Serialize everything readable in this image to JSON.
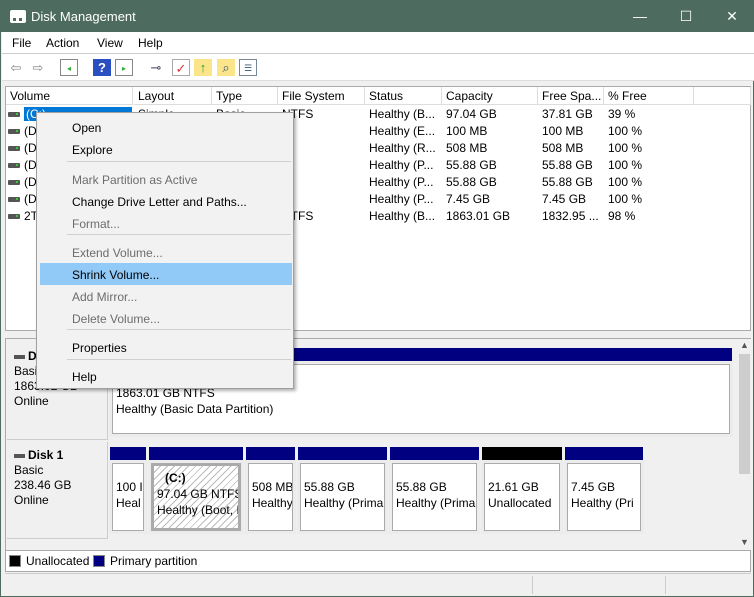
{
  "window": {
    "title": "Disk Management",
    "minimize": "—",
    "maximize": "☐",
    "close": "✕"
  },
  "menu": [
    "File",
    "Action",
    "View",
    "Help"
  ],
  "toolbar": [
    "back-icon",
    "forward-icon",
    "show-hide-console-tree-icon",
    "help-icon",
    "show-hide-action-pane-icon",
    "connect-disk-icon",
    "check-icon",
    "folder-up-icon",
    "search-folder-icon",
    "properties-list-icon"
  ],
  "table": {
    "columns": [
      "Volume",
      "Layout",
      "Type",
      "File System",
      "Status",
      "Capacity",
      "Free Spa...",
      "% Free"
    ],
    "rows": [
      {
        "volume": "(C:)",
        "layout": "Simple",
        "type": "Basic",
        "fs": "NTFS",
        "status": "Healthy (B...",
        "capacity": "97.04 GB",
        "free": "37.81 GB",
        "pct": "39 %"
      },
      {
        "volume": "(D",
        "layout": "",
        "type": "",
        "fs": "",
        "status": "Healthy (E...",
        "capacity": "100 MB",
        "free": "100 MB",
        "pct": "100 %"
      },
      {
        "volume": "(D",
        "layout": "",
        "type": "",
        "fs": "",
        "status": "Healthy (R...",
        "capacity": "508 MB",
        "free": "508 MB",
        "pct": "100 %"
      },
      {
        "volume": "(D",
        "layout": "",
        "type": "",
        "fs": "",
        "status": "Healthy (P...",
        "capacity": "55.88 GB",
        "free": "55.88 GB",
        "pct": "100 %"
      },
      {
        "volume": "(D",
        "layout": "",
        "type": "",
        "fs": "",
        "status": "Healthy (P...",
        "capacity": "55.88 GB",
        "free": "55.88 GB",
        "pct": "100 %"
      },
      {
        "volume": "(D",
        "layout": "",
        "type": "",
        "fs": "",
        "status": "Healthy (P...",
        "capacity": "7.45 GB",
        "free": "7.45 GB",
        "pct": "100 %"
      },
      {
        "volume": "2T",
        "layout": "",
        "type": "",
        "fs": "NTFS",
        "status": "Healthy (B...",
        "capacity": "1863.01 GB",
        "free": "1832.95 ...",
        "pct": "98 %"
      }
    ]
  },
  "disks": [
    {
      "name": "D",
      "type": "Basi",
      "size": "1863.02 GB",
      "state": "Online",
      "partitions": [
        {
          "label": "",
          "line1": "1863.01 GB NTFS",
          "line2": "Healthy (Basic Data Partition)"
        }
      ]
    },
    {
      "name": "Disk 1",
      "type": "Basic",
      "size": "238.46 GB",
      "state": "Online",
      "partitions": [
        {
          "label": "",
          "line1": "100 I",
          "line2": "Heal"
        },
        {
          "label": "(C:)",
          "line1": "97.04 GB NTFS",
          "line2": "Healthy (Boot, I"
        },
        {
          "label": "",
          "line1": "508 MB",
          "line2": "Healthy"
        },
        {
          "label": "",
          "line1": "55.88 GB",
          "line2": "Healthy (Prima"
        },
        {
          "label": "",
          "line1": "55.88 GB",
          "line2": "Healthy (Prima"
        },
        {
          "label": "",
          "line1": "21.61 GB",
          "line2": "Unallocated"
        },
        {
          "label": "",
          "line1": "7.45 GB",
          "line2": "Healthy (Pri"
        }
      ]
    }
  ],
  "legend": [
    {
      "label": "Unallocated",
      "color": "#000000"
    },
    {
      "label": "Primary partition",
      "color": "#000080"
    }
  ],
  "context_menu": [
    {
      "label": "Open",
      "enabled": true
    },
    {
      "label": "Explore",
      "enabled": true
    },
    {
      "label": "Mark Partition as Active",
      "enabled": false
    },
    {
      "label": "Change Drive Letter and Paths...",
      "enabled": true
    },
    {
      "label": "Format...",
      "enabled": false
    },
    {
      "label": "Extend Volume...",
      "enabled": false
    },
    {
      "label": "Shrink Volume...",
      "enabled": true,
      "highlighted": true
    },
    {
      "label": "Add Mirror...",
      "enabled": false
    },
    {
      "label": "Delete Volume...",
      "enabled": false
    },
    {
      "label": "Properties",
      "enabled": true
    },
    {
      "label": "Help",
      "enabled": true
    }
  ]
}
